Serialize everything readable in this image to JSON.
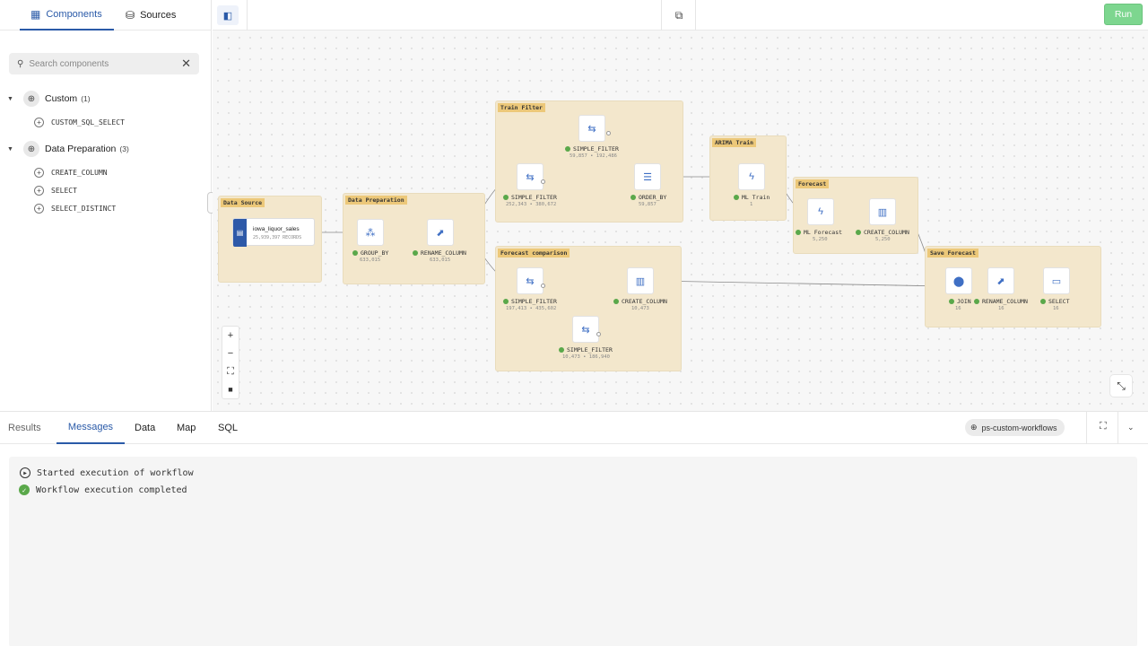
{
  "left_panel": {
    "tabs": [
      {
        "label": "Components",
        "icon": "grid-icon",
        "active": true
      },
      {
        "label": "Sources",
        "icon": "database-icon",
        "active": false
      }
    ],
    "search": {
      "placeholder": "Search components"
    },
    "categories": [
      {
        "label": "Custom",
        "count": "(1)",
        "items": [
          "CUSTOM_SQL_SELECT"
        ]
      },
      {
        "label": "Data Preparation",
        "count": "(3)",
        "items": [
          "CREATE_COLUMN",
          "SELECT",
          "SELECT_DISTINCT"
        ]
      }
    ]
  },
  "toolbar": {
    "run_label": "Run"
  },
  "workflow": {
    "groups": {
      "data_source": "Data Source",
      "data_preparation": "Data Preparation",
      "train_filter": "Train Filter",
      "forecast_comparison": "Forecast comparison",
      "arima_train": "ARIMA Train",
      "forecast": "Forecast",
      "save_forecast": "Save Forecast"
    },
    "source": {
      "name": "iowa_liquor_sales",
      "records": "25,939,397 RECORDS"
    },
    "nodes": {
      "group_by": {
        "label": "GROUP_BY",
        "count": "633,015"
      },
      "rename_column_1": {
        "label": "RENAME_COLUMN",
        "count": "633,015"
      },
      "simple_filter_train_top": {
        "label": "SIMPLE_FILTER",
        "count": "59,857 • 192,486"
      },
      "simple_filter_train": {
        "label": "SIMPLE_FILTER",
        "count": "252,343 • 380,672"
      },
      "order_by": {
        "label": "ORDER_BY",
        "count": "59,857"
      },
      "ml_train": {
        "label": "ML Train",
        "count": "1"
      },
      "ml_forecast": {
        "label": "ML Forecast",
        "count": "5,250"
      },
      "create_column_forecast": {
        "label": "CREATE_COLUMN",
        "count": "5,250"
      },
      "simple_filter_cmp": {
        "label": "SIMPLE_FILTER",
        "count": "197,413 • 435,602"
      },
      "create_column_cmp": {
        "label": "CREATE_COLUMN",
        "count": "10,473"
      },
      "simple_filter_cmp_bottom": {
        "label": "SIMPLE_FILTER",
        "count": "10,473 • 186,940"
      },
      "join": {
        "label": "JOIN",
        "count": "16"
      },
      "rename_column_2": {
        "label": "RENAME_COLUMN",
        "count": "16"
      },
      "select": {
        "label": "SELECT",
        "count": "16"
      }
    }
  },
  "bottom_panel": {
    "tabs": [
      {
        "label": "Results",
        "active": false
      },
      {
        "label": "Messages",
        "active": true
      },
      {
        "label": "Data",
        "active": false
      },
      {
        "label": "Map",
        "active": false
      },
      {
        "label": "SQL",
        "active": false
      }
    ],
    "connection": "ps-custom-workflows",
    "messages": [
      {
        "icon": "play-circle-icon",
        "text": "Started execution of workflow"
      },
      {
        "icon": "check-circle-icon",
        "text": "Workflow execution completed"
      }
    ]
  },
  "colors": {
    "accent": "#2a5aa8",
    "run": "#7dd68f",
    "group_bg": "#f3e7cc",
    "group_label": "#ecc879",
    "success": "#5aa84a"
  }
}
